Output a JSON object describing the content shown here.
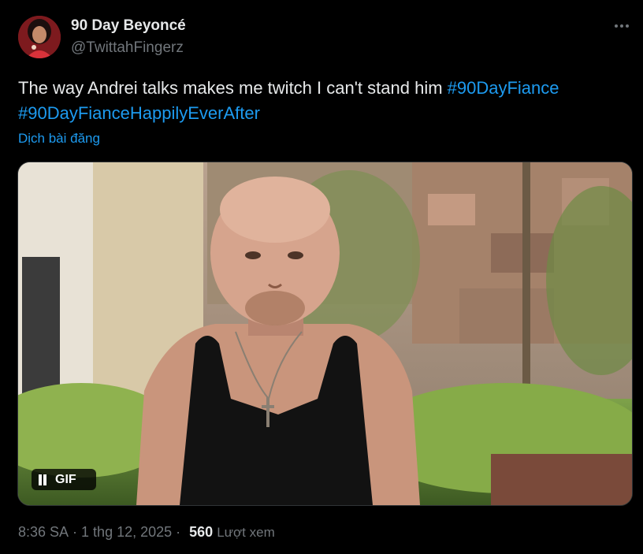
{
  "author": {
    "display_name": "90 Day Beyoncé",
    "handle": "@TwittahFingerz"
  },
  "tweet": {
    "text_plain": "The way Andrei talks makes me twitch I can't stand him ",
    "hashtags": [
      "#90DayFiance",
      "#90DayFianceHappilyEverAfter"
    ],
    "translate_label": "Dịch bài đăng"
  },
  "media": {
    "badge_label": "GIF",
    "badge_icon": "pause-icon"
  },
  "meta": {
    "time": "8:36 SA",
    "separator": "·",
    "date": "1 thg 12, 2025",
    "views_count": "560",
    "views_label": "Lượt xem"
  },
  "colors": {
    "background": "#000000",
    "text": "#e7e9ea",
    "secondary": "#71767b",
    "link": "#1d9bf0"
  }
}
